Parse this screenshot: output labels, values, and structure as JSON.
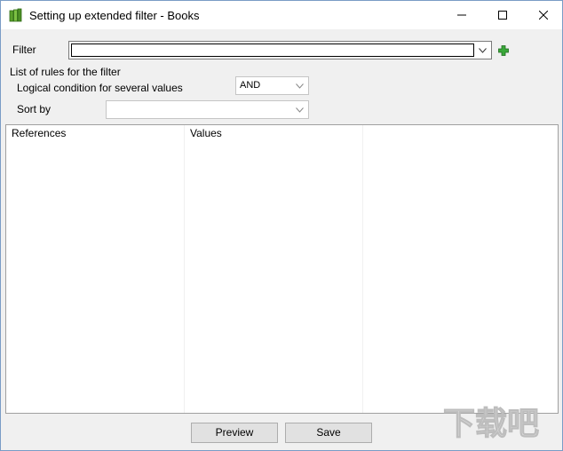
{
  "window": {
    "title": "Setting up extended filter - Books"
  },
  "filter": {
    "label": "Filter",
    "value": ""
  },
  "rules": {
    "section_label": "List of rules for the filter",
    "logical_label": "Logical condition for several values",
    "logical_value": "AND",
    "sort_label": "Sort by",
    "sort_value": ""
  },
  "grid": {
    "columns": [
      "References",
      "Values",
      ""
    ]
  },
  "buttons": {
    "preview": "Preview",
    "save": "Save"
  },
  "watermark": {
    "text": "下载吧"
  },
  "colors": {
    "accent_green": "#2e8b2e",
    "window_bg": "#f0f0f0",
    "border": "#7a9cc6"
  },
  "icons": [
    "books-app-icon",
    "minimize-icon",
    "maximize-icon",
    "close-icon",
    "chevron-down-icon",
    "plus-icon"
  ]
}
